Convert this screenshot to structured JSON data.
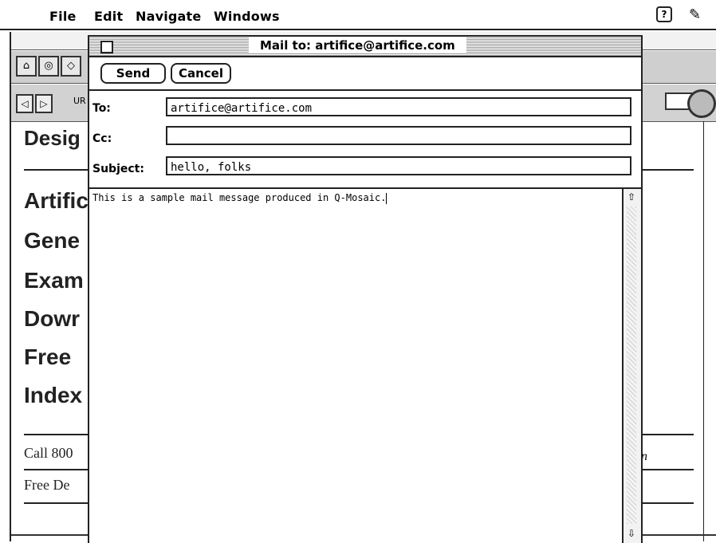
{
  "menubar": {
    "items": [
      "File",
      "Edit",
      "Navigate",
      "Windows"
    ],
    "help_label": "?"
  },
  "browser": {
    "url_label": "UR",
    "heading": "Desig",
    "links": [
      "Artific",
      "Gene",
      "Exam",
      "Dowr",
      "Free",
      "Index"
    ],
    "footer_lines": [
      "Call 800",
      "Free De"
    ],
    "italic_fragment": "n"
  },
  "mail": {
    "title": "Mail to: artifice@artifice.com",
    "send_label": "Send",
    "cancel_label": "Cancel",
    "to_label": "To:",
    "to_value": "artifice@artifice.com",
    "cc_label": "Cc:",
    "cc_value": "",
    "subject_label": "Subject:",
    "subject_value": "hello, folks",
    "body_text": "This is a sample mail message produced in Q-Mosaic."
  },
  "icons": {
    "apple": "apple-logo-icon",
    "help": "help-icon",
    "balloon": "balloon-help-icon",
    "close": "close-box-icon",
    "scroll_up": "scroll-up-arrow-icon",
    "scroll_down": "scroll-down-arrow-icon"
  }
}
